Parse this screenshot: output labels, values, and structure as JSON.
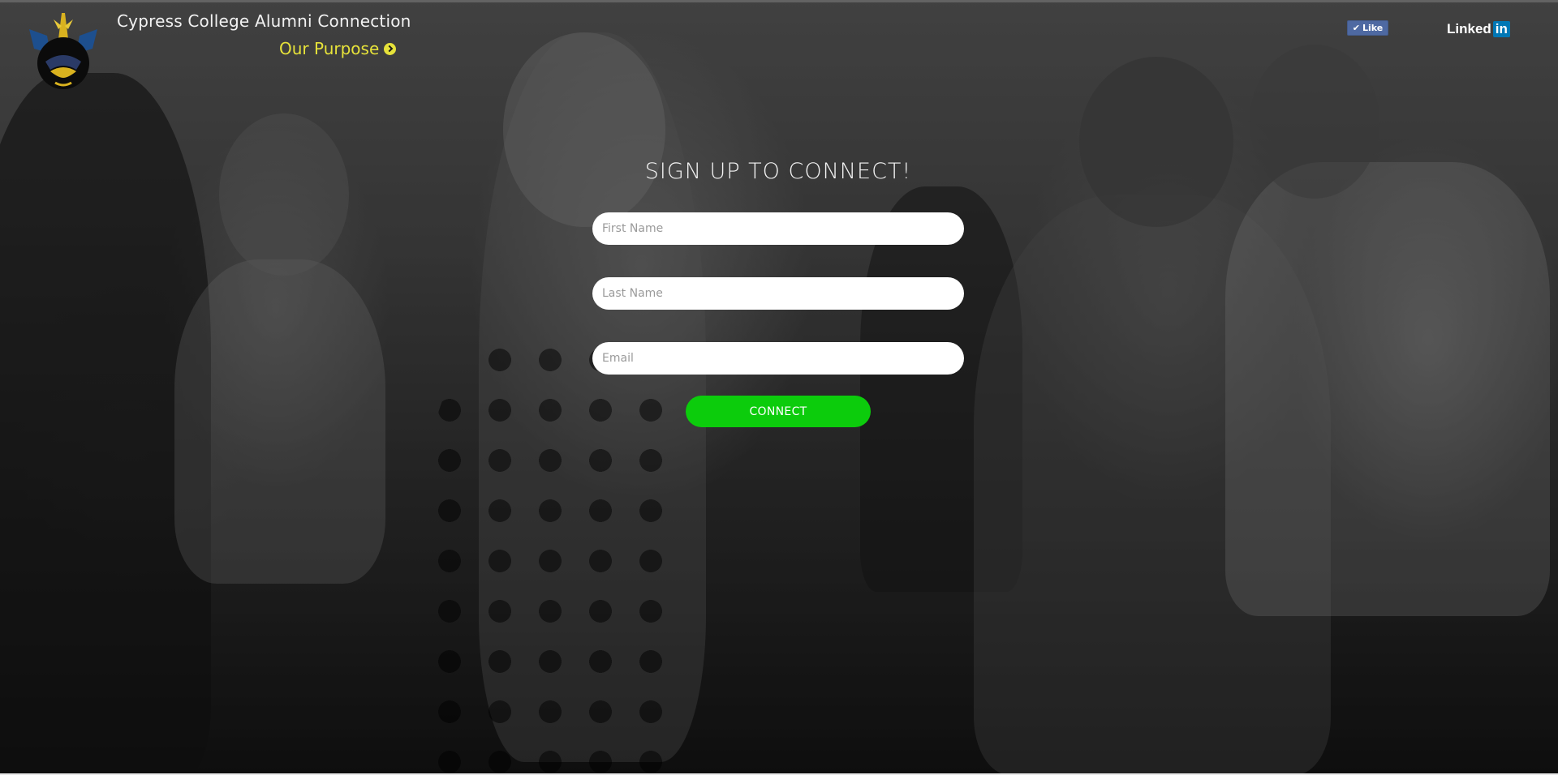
{
  "header": {
    "site_title": "Cypress College Alumni Connection",
    "purpose_link": "Our Purpose",
    "purpose_icon": "chevron-right-circle-icon"
  },
  "social": {
    "facebook_like_label": "Like",
    "facebook_icon": "check-icon",
    "linkedin_text": "Linked",
    "linkedin_badge": "in"
  },
  "signup": {
    "title": "SIGN UP TO CONNECT!",
    "first_name_placeholder": "First Name",
    "last_name_placeholder": "Last Name",
    "email_placeholder": "Email",
    "connect_button": "CONNECT"
  },
  "colors": {
    "accent_yellow": "#e6e23a",
    "button_green": "#0ccc0c",
    "facebook_blue": "#4e69a2",
    "linkedin_blue": "#0077b5"
  }
}
